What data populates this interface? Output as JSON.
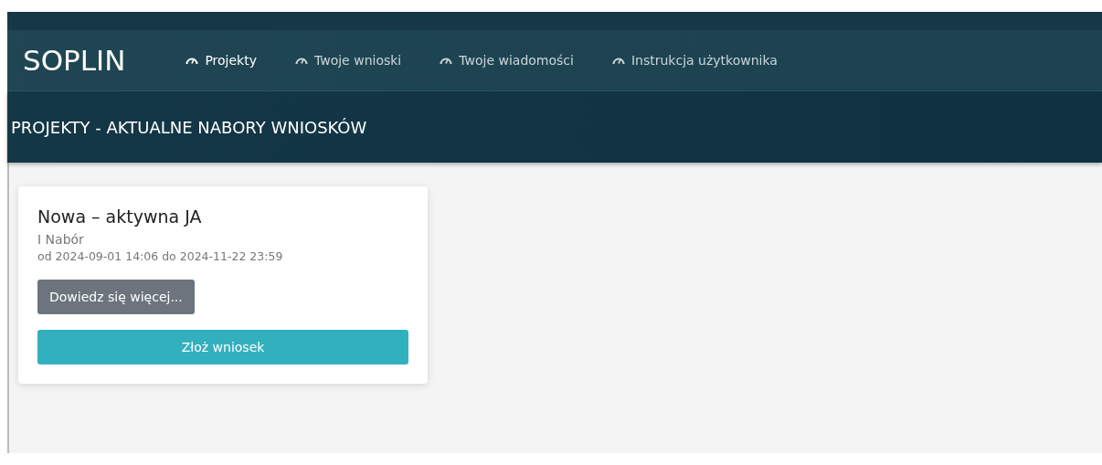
{
  "navbar": {
    "brand": "SOPLIN",
    "items": [
      {
        "label": "Projekty",
        "selected": true
      },
      {
        "label": "Twoje wnioski",
        "selected": false
      },
      {
        "label": "Twoje wiadomości",
        "selected": false
      },
      {
        "label": "Instrukcja użytkownika",
        "selected": false
      }
    ]
  },
  "page_title": "PROJEKTY - AKTUALNE NABORY WNIOSKÓW",
  "cards": [
    {
      "title": "Nowa – aktywna JA",
      "subtitle": "I Nabór",
      "dates": "od 2024-09-01 14:06 do 2024-11-22 23:59",
      "buttons": [
        {
          "kind": "secondary",
          "label": "Dowiedz się więcej..."
        },
        {
          "kind": "primary",
          "label": "Złoż wniosek"
        }
      ]
    }
  ]
}
